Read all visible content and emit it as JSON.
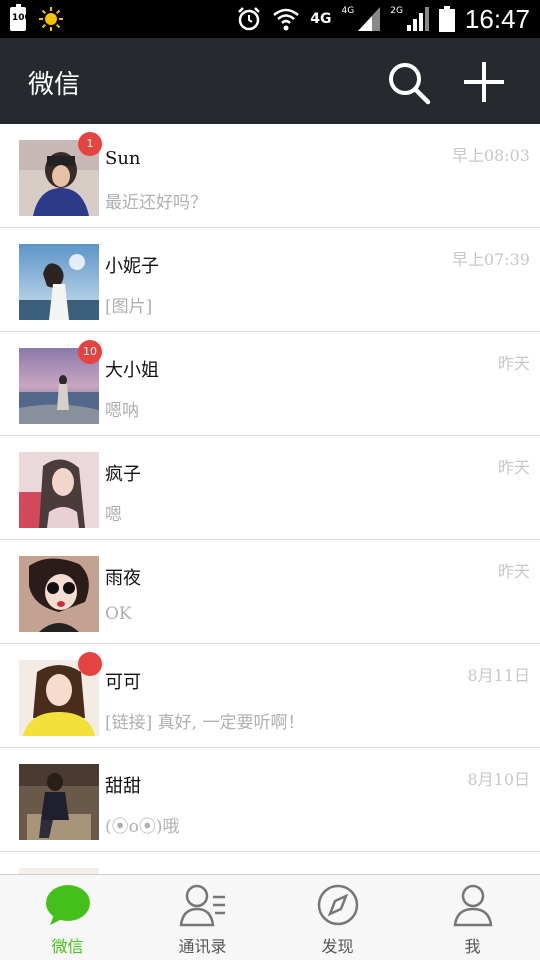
{
  "status_bar": {
    "battery_small": "100",
    "net_4g": "4G",
    "net_4g_small": "4G",
    "net_2g_small": "2G",
    "time": "16:47"
  },
  "header": {
    "title": "微信"
  },
  "chats": [
    {
      "name": "Sun",
      "message": "最近还好吗？",
      "time": "早上08:03",
      "badge": "1",
      "avatar_colors": [
        "#d8c7c0",
        "#2a2f6a"
      ]
    },
    {
      "name": "小妮子",
      "message": "[图片]",
      "time": "早上07:39",
      "badge": "",
      "avatar_colors": [
        "#a8c8e8",
        "#f0f0f0"
      ]
    },
    {
      "name": "大小姐",
      "message": "嗯呐",
      "time": "昨天",
      "badge": "10",
      "avatar_colors": [
        "#b7a1c8",
        "#556a8a"
      ]
    },
    {
      "name": "疯子",
      "message": "嗯",
      "time": "昨天",
      "badge": "",
      "avatar_colors": [
        "#e8d8d8",
        "#d05060"
      ]
    },
    {
      "name": "雨夜",
      "message": "OK",
      "time": "昨天",
      "badge": "",
      "avatar_colors": [
        "#c9a99a",
        "#2a1a16"
      ]
    },
    {
      "name": "可可",
      "message": "[链接] 真好, 一定要听啊！",
      "time": "8月11日",
      "badge": "dot",
      "avatar_colors": [
        "#f6e55a",
        "#4a2a1a"
      ]
    },
    {
      "name": "甜甜",
      "message": "(⦿o⦿)哦",
      "time": "8月10日",
      "badge": "",
      "avatar_colors": [
        "#6b5a48",
        "#2a2a30"
      ]
    }
  ],
  "tabs": [
    {
      "label": "微信",
      "active": true
    },
    {
      "label": "通讯录",
      "active": false
    },
    {
      "label": "发现",
      "active": false
    },
    {
      "label": "我",
      "active": false
    }
  ],
  "colors": {
    "accent": "#45c01a",
    "header_bg": "#262a2f",
    "badge": "#e64340"
  }
}
